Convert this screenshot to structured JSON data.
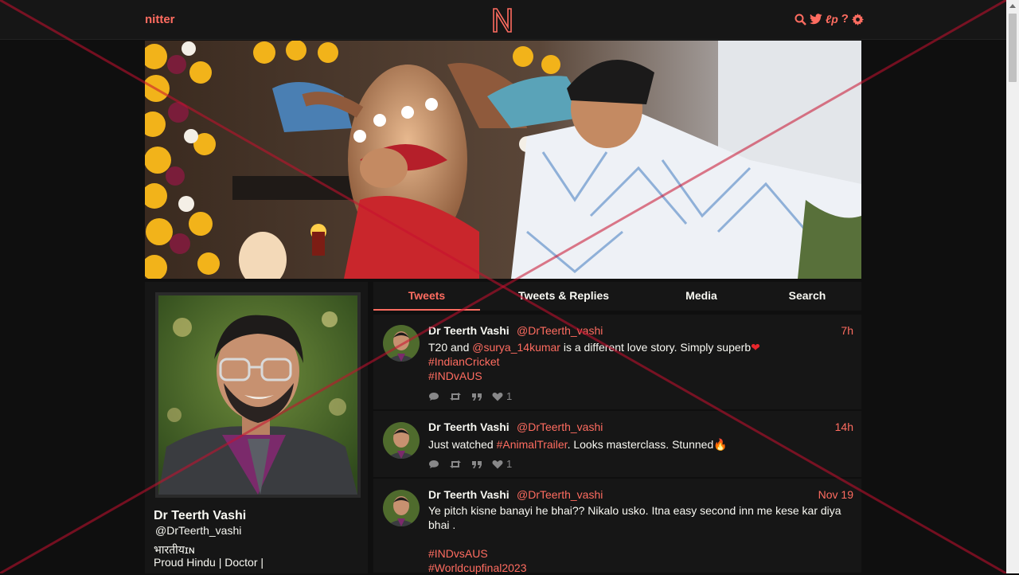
{
  "nav": {
    "brand": "nitter",
    "icons": [
      "search-icon",
      "twitter-bird-icon",
      "liberapay-icon",
      "help-icon",
      "gear-icon"
    ]
  },
  "colors": {
    "accent": "#ff6c60",
    "bg": "#0f0f0f",
    "panel": "#161616",
    "fg": "#f8f8f2"
  },
  "profile": {
    "fullname": "Dr Teerth Vashi",
    "username": "@DrTeerth_vashi",
    "bio_line1": "भारतीयɪɴ",
    "bio_line2": "Proud Hindu | Doctor |"
  },
  "tabs": [
    {
      "label": "Tweets",
      "active": true
    },
    {
      "label": "Tweets & Replies",
      "active": false
    },
    {
      "label": "Media",
      "active": false
    },
    {
      "label": "Search",
      "active": false
    }
  ],
  "tweets": [
    {
      "name": "Dr Teerth Vashi",
      "handle": "@DrTeerth_vashi",
      "date": "7h",
      "text_a": "T20 and ",
      "mention": "@surya_14kumar",
      "text_b": " is a different love story. Simply superb",
      "emoji": "❤",
      "hashtags": [
        "#IndianCricket",
        "#INDvAUS"
      ],
      "likes": "1"
    },
    {
      "name": "Dr Teerth Vashi",
      "handle": "@DrTeerth_vashi",
      "date": "14h",
      "text_a": "Just watched ",
      "hashtag_inline": "#AnimalTrailer",
      "text_b": ". Looks masterclass. Stunned",
      "emoji": "🔥",
      "likes": "1"
    },
    {
      "name": "Dr Teerth Vashi",
      "handle": "@DrTeerth_vashi",
      "date": "Nov 19",
      "text_a": "Ye pitch kisne banayi he bhai?? Nikalo usko. Itna easy second inn me kese kar diya bhai .",
      "hashtags": [
        "#INDvsAUS",
        "#Worldcupfinal2023"
      ]
    }
  ]
}
